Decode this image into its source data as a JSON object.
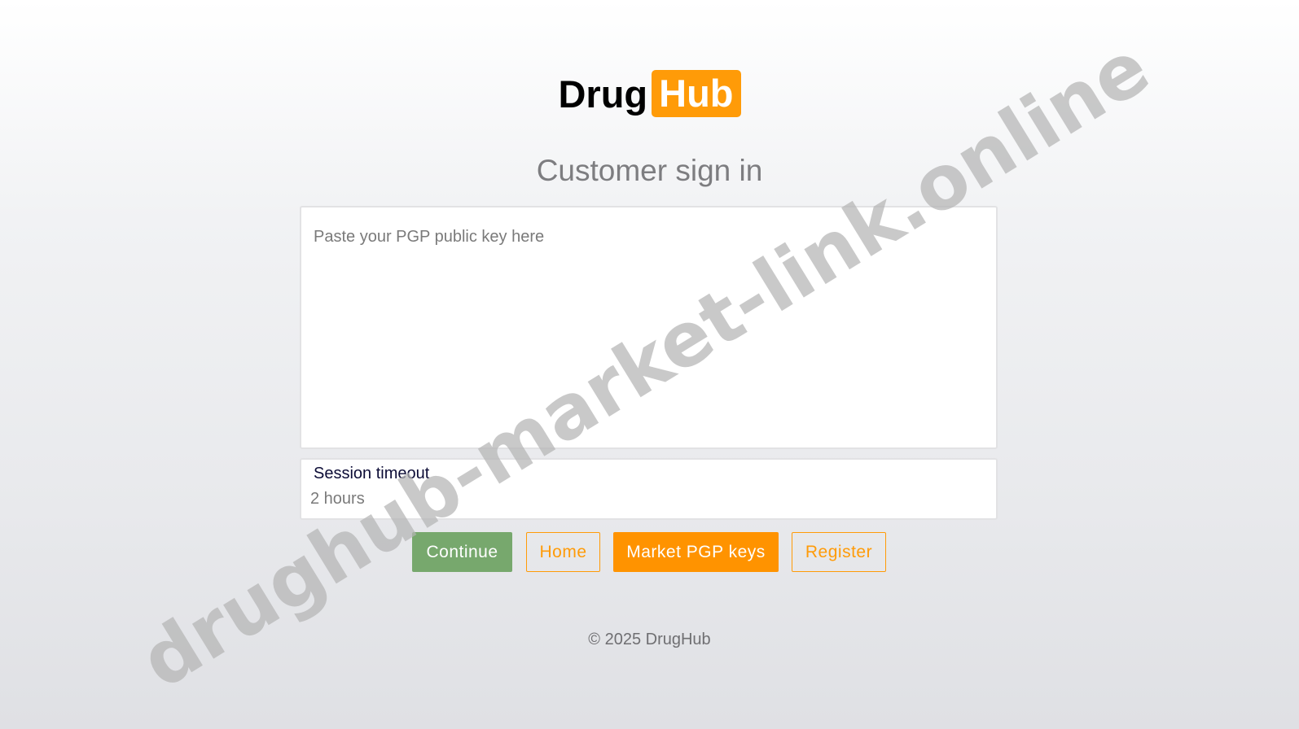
{
  "logo": {
    "part1": "Drug",
    "part2": "Hub",
    "accent_color": "#ff9b08"
  },
  "title": "Customer sign in",
  "pgp_key": {
    "value": "",
    "placeholder": "Paste your PGP public key here"
  },
  "session": {
    "label": "Session timeout",
    "value": "2 hours"
  },
  "buttons": {
    "continue": "Continue",
    "home": "Home",
    "market_pgp_keys": "Market PGP keys",
    "register": "Register"
  },
  "footer": "© 2025 DrugHub",
  "watermark": "drughub-market-link.online",
  "colors": {
    "continue_bg": "#77a86d",
    "primary_orange": "#ff9300",
    "label_text": "#0c0c36"
  }
}
